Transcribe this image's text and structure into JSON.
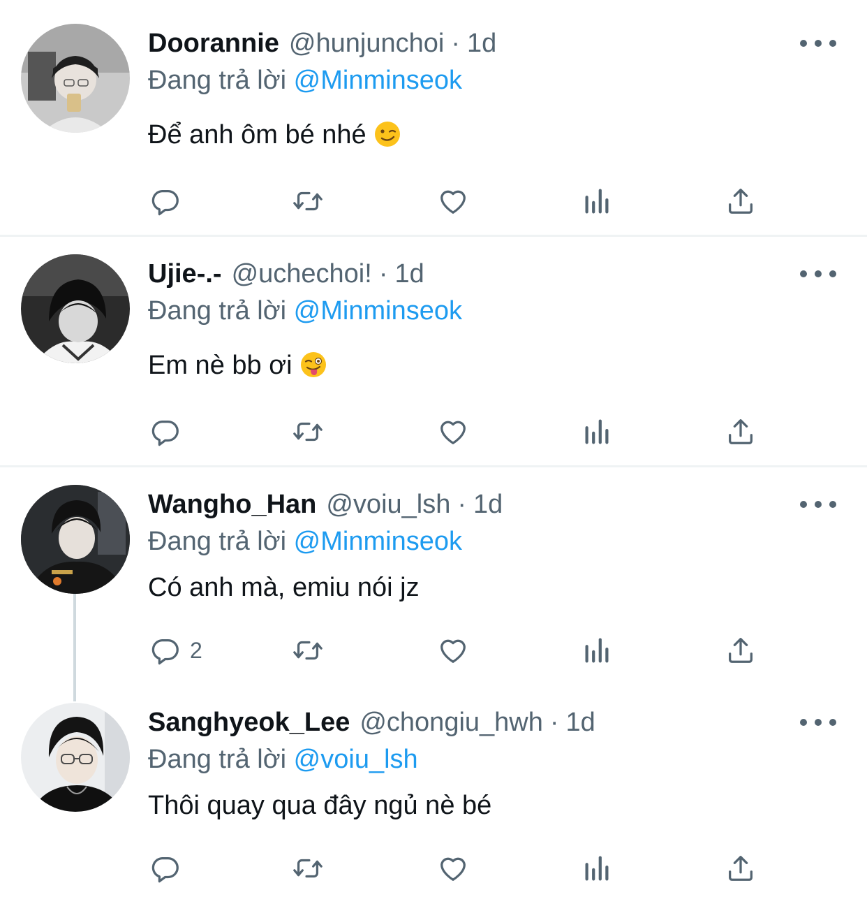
{
  "replying_prefix": "Đang trả lời",
  "separator": "·",
  "tweets": [
    {
      "name": "Doorannie",
      "handle": "@hunjunchoi",
      "time": "1d",
      "reply_to": "@Minminseok",
      "text": "Để anh ôm bé nhé",
      "emoji": "winking-face",
      "reply_count": ""
    },
    {
      "name": "Ujie-.-",
      "handle": "@uchechoi!",
      "time": "1d",
      "reply_to": "@Minminseok",
      "text": "Em nè bb ơi",
      "emoji": "winking-face-with-tongue",
      "reply_count": ""
    },
    {
      "name": "Wangho_Han",
      "handle": "@voiu_lsh",
      "time": "1d",
      "reply_to": "@Minminseok",
      "text": "Có anh mà, emiu nói jz",
      "emoji": "",
      "reply_count": "2"
    },
    {
      "name": "Sanghyeok_Lee",
      "handle": "@chongiu_hwh",
      "time": "1d",
      "reply_to": "@voiu_lsh",
      "text": "Thôi quay qua đây ngủ nè bé",
      "emoji": "",
      "reply_count": ""
    }
  ],
  "colors": {
    "accent": "#1d9bf0",
    "secondary_text": "#536471",
    "primary_text": "#0f1419",
    "divider": "#eff3f4",
    "thread_line": "#cfd9de"
  },
  "action_icons": [
    "reply-icon",
    "retweet-icon",
    "like-icon",
    "analytics-icon",
    "share-icon"
  ]
}
